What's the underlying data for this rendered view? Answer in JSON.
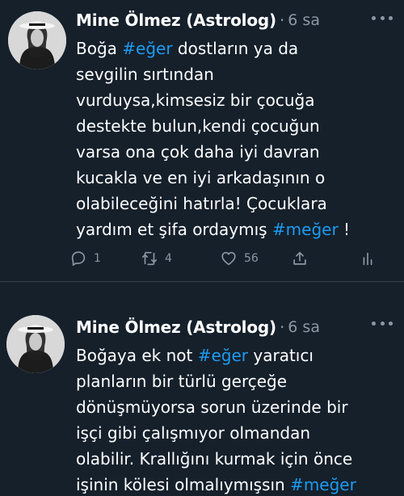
{
  "tweets": [
    {
      "author": "Mine Ölmez (Astrolog)",
      "separator": "·",
      "time": "6 sa",
      "lines": [
        [
          {
            "t": "Boğa "
          },
          {
            "t": "#eğer",
            "tag": true
          },
          {
            "t": " dostların ya da"
          }
        ],
        [
          {
            "t": "sevgilin sırtından"
          }
        ],
        [
          {
            "t": "vurduysa,kimsesiz bir çocuğa"
          }
        ],
        [
          {
            "t": "destekte bulun,kendi çocuğun"
          }
        ],
        [
          {
            "t": "varsa ona çok daha iyi davran"
          }
        ],
        [
          {
            "t": "kucakla ve en iyi arkadaşının o"
          }
        ],
        [
          {
            "t": "olabileceğini hatırla! Çocuklara"
          }
        ],
        [
          {
            "t": "yardım et şifa ordaymış "
          },
          {
            "t": "#meğer",
            "tag": true
          },
          {
            "t": " !"
          }
        ]
      ],
      "actions": {
        "reply_count": "1",
        "retweet_count": "4",
        "like_count": "56"
      }
    },
    {
      "author": "Mine Ölmez (Astrolog)",
      "separator": "·",
      "time": "6 sa",
      "lines": [
        [
          {
            "t": "Boğaya ek not "
          },
          {
            "t": "#eğer",
            "tag": true
          },
          {
            "t": " yaratıcı"
          }
        ],
        [
          {
            "t": "planların bir türlü gerçeğe"
          }
        ],
        [
          {
            "t": "dönüşmüyorsa sorun üzerinde bir"
          }
        ],
        [
          {
            "t": "işçi gibi çalışmıyor olmandan"
          }
        ],
        [
          {
            "t": "olabilir. Krallığını kurmak için önce"
          }
        ],
        [
          {
            "t": "işinin kölesi olmalıymışsın "
          },
          {
            "t": "#meğer",
            "tag": true
          }
        ]
      ]
    }
  ],
  "colors": {
    "background": "#15202b",
    "text": "#ffffff",
    "muted": "#8b98a5",
    "hashtag": "#1d9bf0",
    "divider": "#38444d"
  },
  "icons": [
    "avatar",
    "more-icon",
    "reply-icon",
    "retweet-icon",
    "like-icon",
    "share-icon",
    "stats-icon"
  ]
}
